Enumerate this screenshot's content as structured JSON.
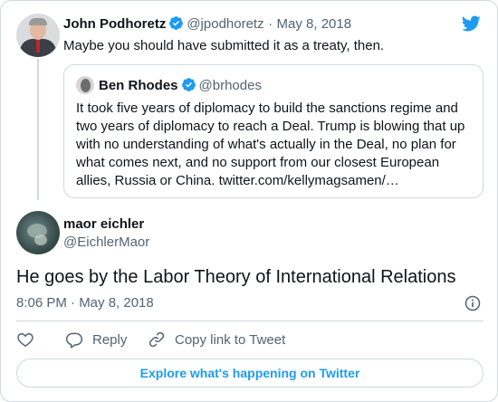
{
  "parent_tweet": {
    "author_name": "John Podhoretz",
    "author_handle": "@jpodhoretz",
    "separator": "·",
    "date": "May 8, 2018",
    "text": "Maybe you should have submitted it as a treaty, then."
  },
  "quoted_tweet": {
    "author_name": "Ben Rhodes",
    "author_handle": "@brhodes",
    "text": "It took five years of diplomacy to build the sanctions regime and two years of diplomacy to reach a Deal. Trump is blowing that up with no understanding of what's actually in the Deal, no plan for what comes next, and no support from our closest European allies, Russia or China. twitter.com/kellymagsamen/…"
  },
  "main_tweet": {
    "author_name": "maor eichler",
    "author_handle": "@EichlerMaor",
    "text": "He goes by the Labor Theory of International Relations",
    "timestamp": "8:06 PM · May 8, 2018"
  },
  "actions": {
    "like_icon": "heart-icon",
    "reply_label": "Reply",
    "copy_link_label": "Copy link to Tweet"
  },
  "explore_label": "Explore what's happening on Twitter",
  "colors": {
    "accent": "#1d9bf0",
    "text": "#0f1419",
    "secondary": "#536471",
    "border": "#cfd9de"
  }
}
